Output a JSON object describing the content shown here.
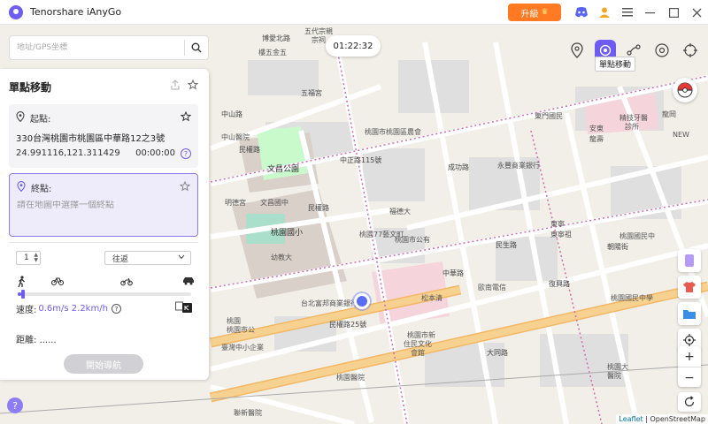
{
  "app": {
    "title": "Tenorshare iAnyGo",
    "upgrade_label": "升級"
  },
  "search": {
    "placeholder": "地址/GPS坐標",
    "value": ""
  },
  "timer": "01:22:32",
  "modes": {
    "active_tooltip": "單點移動"
  },
  "panel": {
    "title": "單點移動",
    "start": {
      "label": "起點:",
      "address": "330台灣桃園市桃園區中華路12之3號",
      "coordinates": "24.991116,121.311429",
      "time": "00:00:00"
    },
    "end": {
      "label": "終點:",
      "placeholder": "請在地圖中選擇一個終點",
      "value": ""
    },
    "count": "1",
    "route_mode": "往返",
    "speed_label": "速度:",
    "speed_value": "0.6m/s 2.2km/h",
    "speed_fraction": 0.02,
    "distance_label": "距離:",
    "distance_value": "......",
    "start_button": "開始導航"
  },
  "map": {
    "attribution_leaflet": "Leaflet",
    "attribution_osm": "| OpenStreetMap",
    "labels": [
      {
        "text": "博愛北路",
        "cls": "road"
      },
      {
        "text": "樓五金五",
        "cls": ""
      },
      {
        "text": "五代宗親",
        "cls": ""
      },
      {
        "text": "宗祠",
        "cls": ""
      },
      {
        "text": "五福宮",
        "cls": ""
      },
      {
        "text": "中山路",
        "cls": "road"
      },
      {
        "text": "民權路",
        "cls": "road"
      },
      {
        "text": "中山醫院",
        "cls": ""
      },
      {
        "text": "文昌公園",
        "cls": "big"
      },
      {
        "text": "明德宮",
        "cls": ""
      },
      {
        "text": "文昌國中",
        "cls": ""
      },
      {
        "text": "民權路",
        "cls": "road"
      },
      {
        "text": "桃園國小",
        "cls": "big"
      },
      {
        "text": "幼教大",
        "cls": ""
      },
      {
        "text": "桃園市桃園區農會",
        "cls": ""
      },
      {
        "text": "中正路115號",
        "cls": "road"
      },
      {
        "text": "成功路",
        "cls": "road"
      },
      {
        "text": "福德大",
        "cls": ""
      },
      {
        "text": "桃園77藝文町",
        "cls": ""
      },
      {
        "text": "桃園市公有",
        "cls": ""
      },
      {
        "text": "永豐商業銀行",
        "cls": ""
      },
      {
        "text": "台北富邦商業銀行",
        "cls": ""
      },
      {
        "text": "松本清",
        "cls": ""
      },
      {
        "text": "歐南電信",
        "cls": ""
      },
      {
        "text": "中華路",
        "cls": "road"
      },
      {
        "text": "復興路",
        "cls": "road"
      },
      {
        "text": "民生路",
        "cls": "road"
      },
      {
        "text": "東門國民",
        "cls": ""
      },
      {
        "text": "安東",
        "cls": ""
      },
      {
        "text": "龍壽",
        "cls": ""
      },
      {
        "text": "東寧",
        "cls": ""
      },
      {
        "text": "桃園國民中",
        "cls": ""
      },
      {
        "text": "桃園國民中學",
        "cls": ""
      },
      {
        "text": "桃園",
        "cls": ""
      },
      {
        "text": "桃園市公",
        "cls": ""
      },
      {
        "text": "民權路25號",
        "cls": "road"
      },
      {
        "text": "臺灣中小企業",
        "cls": ""
      },
      {
        "text": "桃園市新",
        "cls": ""
      },
      {
        "text": "住民文化",
        "cls": ""
      },
      {
        "text": "會館",
        "cls": ""
      },
      {
        "text": "大同路",
        "cls": "road"
      },
      {
        "text": "桃園大",
        "cls": ""
      },
      {
        "text": "醫院",
        "cls": ""
      },
      {
        "text": "聯新醫院",
        "cls": ""
      },
      {
        "text": "桃園醫院",
        "cls": ""
      },
      {
        "text": "東寧祖",
        "cls": ""
      },
      {
        "text": "朝陽街",
        "cls": "road"
      },
      {
        "text": "精技牙醫",
        "cls": ""
      },
      {
        "text": "診所",
        "cls": ""
      },
      {
        "text": "龍岡",
        "cls": ""
      },
      {
        "text": "NEW",
        "cls": ""
      }
    ]
  },
  "colors": {
    "accent": "#6f5cf2",
    "upgrade": "#ff7a22",
    "main_road": "#f7c679",
    "park": "#c8facc"
  }
}
